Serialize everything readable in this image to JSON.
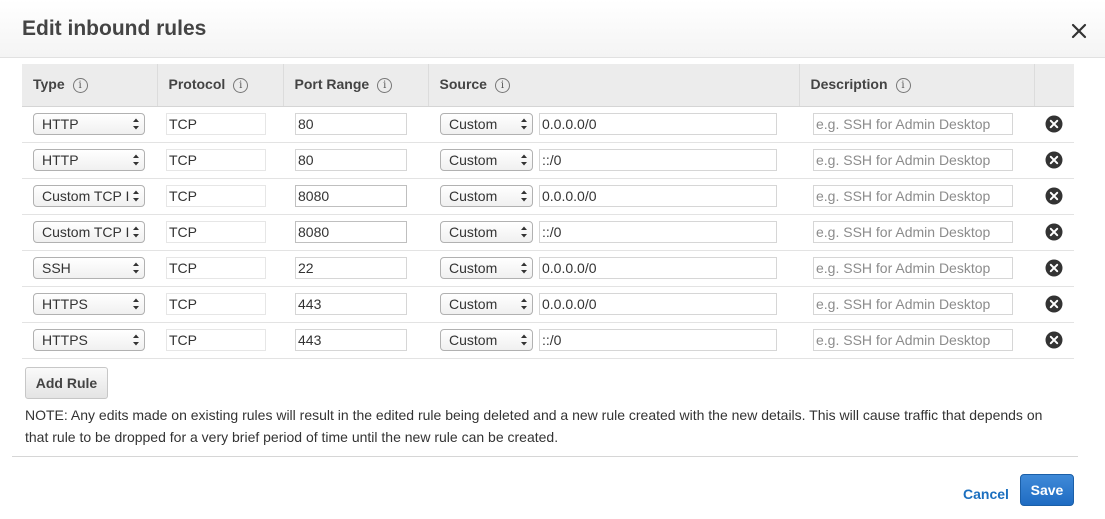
{
  "dialog": {
    "title": "Edit inbound rules",
    "close_icon": "close-icon"
  },
  "table": {
    "headers": {
      "type": "Type",
      "protocol": "Protocol",
      "port_range": "Port Range",
      "source": "Source",
      "description": "Description"
    },
    "info_icon_glyph": "i",
    "rows": [
      {
        "type": "HTTP",
        "protocol": "TCP",
        "port": "80",
        "source_type": "Custom",
        "source_value": "0.0.0.0/0",
        "description_placeholder": "e.g. SSH for Admin Desktop"
      },
      {
        "type": "HTTP",
        "protocol": "TCP",
        "port": "80",
        "source_type": "Custom",
        "source_value": "::/0",
        "description_placeholder": "e.g. SSH for Admin Desktop"
      },
      {
        "type": "Custom TCP I",
        "protocol": "TCP",
        "port": "8080",
        "source_type": "Custom",
        "source_value": "0.0.0.0/0",
        "description_placeholder": "e.g. SSH for Admin Desktop"
      },
      {
        "type": "Custom TCP I",
        "protocol": "TCP",
        "port": "8080",
        "source_type": "Custom",
        "source_value": "::/0",
        "description_placeholder": "e.g. SSH for Admin Desktop"
      },
      {
        "type": "SSH",
        "protocol": "TCP",
        "port": "22",
        "source_type": "Custom",
        "source_value": "0.0.0.0/0",
        "description_placeholder": "e.g. SSH for Admin Desktop"
      },
      {
        "type": "HTTPS",
        "protocol": "TCP",
        "port": "443",
        "source_type": "Custom",
        "source_value": "0.0.0.0/0",
        "description_placeholder": "e.g. SSH for Admin Desktop"
      },
      {
        "type": "HTTPS",
        "protocol": "TCP",
        "port": "443",
        "source_type": "Custom",
        "source_value": "::/0",
        "description_placeholder": "e.g. SSH for Admin Desktop"
      }
    ]
  },
  "add_rule_label": "Add Rule",
  "note": "NOTE: Any edits made on existing rules will result in the edited rule being deleted and a new rule created with the new details. This will cause traffic that depends on that rule to be dropped for a very brief period of time until the new rule can be created.",
  "footer": {
    "cancel_label": "Cancel",
    "save_label": "Save"
  },
  "colors": {
    "accent": "#1f6cc2",
    "link": "#1b6fbf",
    "header_bg": "#ececec"
  }
}
